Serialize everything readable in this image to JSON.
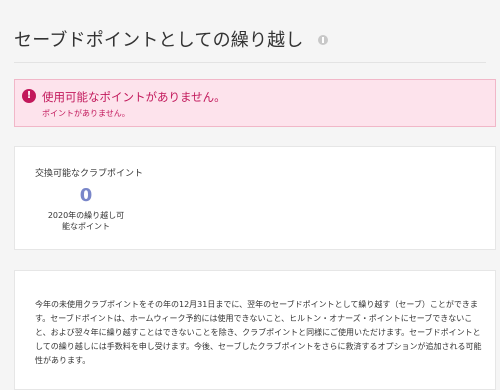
{
  "page": {
    "title": "セーブドポイントとしての繰り越し",
    "info_icon": "info-circle-icon"
  },
  "alert": {
    "icon": "exclamation-circle-icon",
    "icon_glyph": "!",
    "title": "使用可能なポイントがありません。",
    "detail": "ポイントがありません。",
    "color": "#c2185b",
    "background": "#fde3ec"
  },
  "points_card": {
    "label": "交換可能なクラブポイント",
    "value": "0",
    "sublabel": "2020年の繰り越し可能なポイント",
    "value_color": "#7986c9"
  },
  "description": {
    "text": "今年の未使用クラブポイントをその年の12月31日までに、翌年のセーブドポイントとして繰り越す（セーブ）ことができます。セーブドポイントは、ホームウィーク予約には使用できないこと、ヒルトン・オナーズ・ポイントにセーブできないこと、および翌々年に繰り越すことはできないことを除き、クラブポイントと同様にご使用いただけます。セーブドポイントとしての繰り越しには手数料を申し受けます。今後、セーブしたクラブポイントをさらに救済するオプションが追加される可能性があります。"
  }
}
